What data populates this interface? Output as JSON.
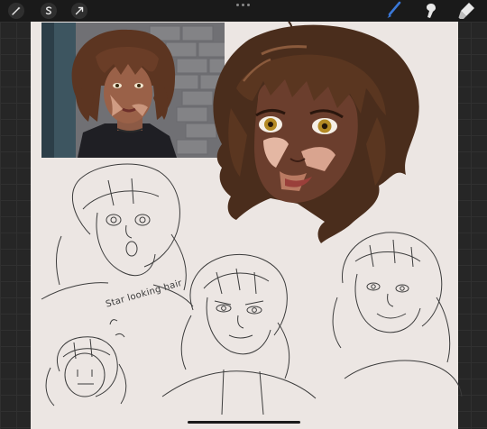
{
  "toolbar": {
    "left_tools": [
      "adjustments-icon",
      "selection-icon",
      "transform-icon"
    ],
    "right_tools": [
      "brush-icon",
      "smudge-icon",
      "eraser-icon"
    ],
    "active_tool": "brush-icon",
    "active_color": "#3a78d8"
  },
  "canvas": {
    "paper_color": "#ece6e3"
  },
  "annotation": {
    "caption": "Star looking hair"
  }
}
